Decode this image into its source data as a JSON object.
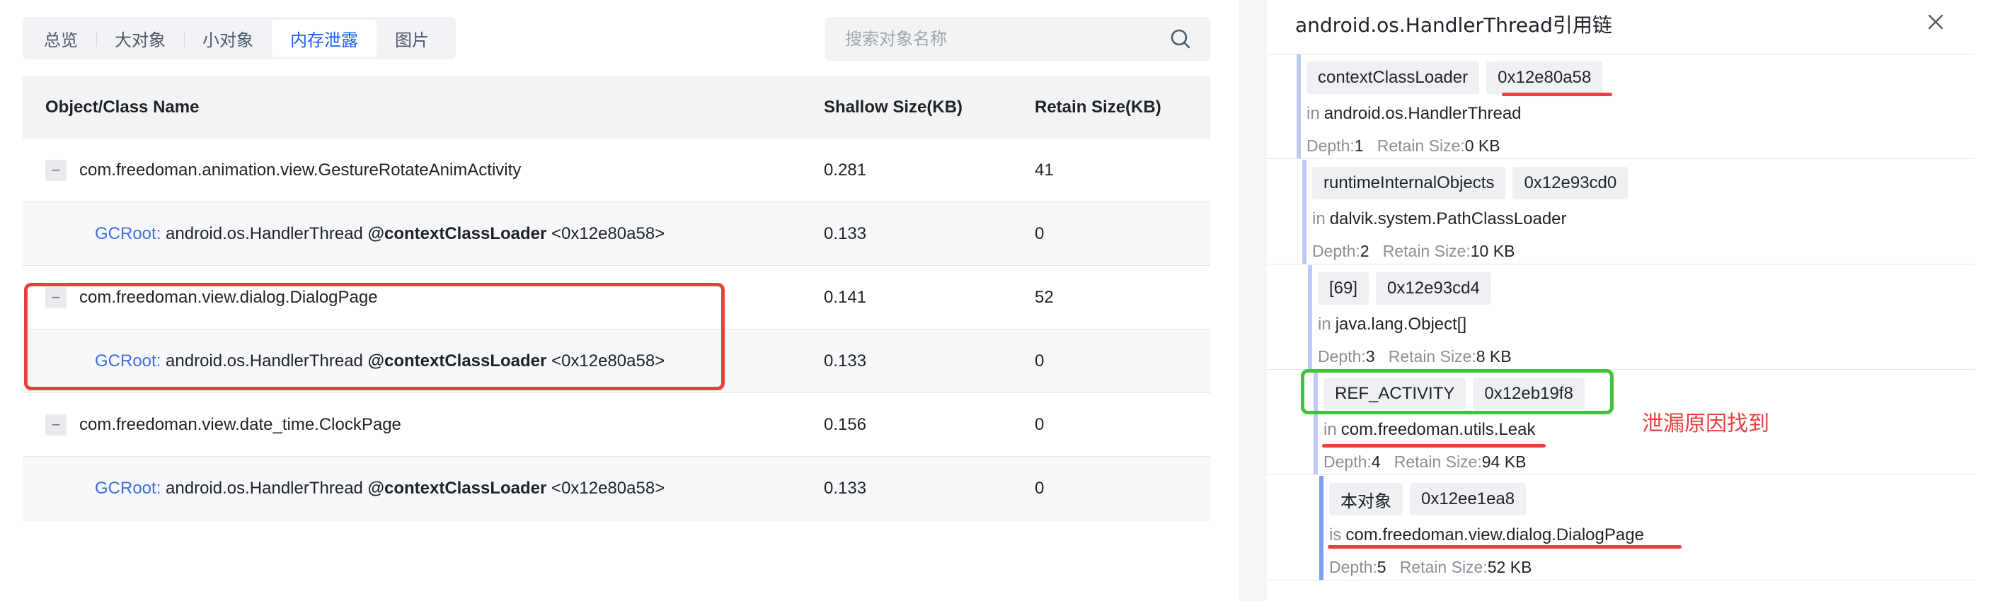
{
  "tabs": [
    {
      "label": "总览"
    },
    {
      "label": "大对象"
    },
    {
      "label": "小对象"
    },
    {
      "label": "内存泄露"
    },
    {
      "label": "图片"
    }
  ],
  "search": {
    "placeholder": "搜索对象名称",
    "value": ""
  },
  "table": {
    "headers": {
      "name": "Object/Class Name",
      "shallow": "Shallow Size(KB)",
      "retain": "Retain Size(KB)"
    },
    "rows": [
      {
        "name": "com.freedoman.animation.view.GestureRotateAnimActivity",
        "shallow": "0.281",
        "retain": "41"
      },
      {
        "gc_label": "GCRoot:",
        "class": "android.os.HandlerThread",
        "field": "@contextClassLoader",
        "addr": "<0x12e80a58>",
        "shallow": "0.133",
        "retain": "0"
      },
      {
        "name": "com.freedoman.view.dialog.DialogPage",
        "shallow": "0.141",
        "retain": "52"
      },
      {
        "gc_label": "GCRoot:",
        "class": "android.os.HandlerThread",
        "field": "@contextClassLoader",
        "addr": "<0x12e80a58>",
        "shallow": "0.133",
        "retain": "0"
      },
      {
        "name": "com.freedoman.view.date_time.ClockPage",
        "shallow": "0.156",
        "retain": "0"
      },
      {
        "gc_label": "GCRoot:",
        "class": "android.os.HandlerThread",
        "field": "@contextClassLoader",
        "addr": "<0x12e80a58>",
        "shallow": "0.133",
        "retain": "0"
      }
    ],
    "collapse_symbol": "−"
  },
  "panel": {
    "title": "android.os.HandlerThread引用链",
    "nodes": [
      {
        "tag": "contextClassLoader",
        "addr": "0x12e80a58",
        "prefix": "in",
        "class": "android.os.HandlerThread",
        "depth_label": "Depth:",
        "depth": "1",
        "retain_label": "Retain Size:",
        "retain": "0 KB"
      },
      {
        "tag": "runtimeInternalObjects",
        "addr": "0x12e93cd0",
        "prefix": "in",
        "class": "dalvik.system.PathClassLoader",
        "depth_label": "Depth:",
        "depth": "2",
        "retain_label": "Retain Size:",
        "retain": "10 KB"
      },
      {
        "tag": "[69]",
        "addr": "0x12e93cd4",
        "prefix": "in",
        "class": "java.lang.Object[]",
        "depth_label": "Depth:",
        "depth": "3",
        "retain_label": "Retain Size:",
        "retain": "8 KB"
      },
      {
        "tag": "REF_ACTIVITY",
        "addr": "0x12eb19f8",
        "prefix": "in",
        "class": "com.freedoman.utils.Leak",
        "depth_label": "Depth:",
        "depth": "4",
        "retain_label": "Retain Size:",
        "retain": "94 KB"
      },
      {
        "tag": "本对象",
        "addr": "0x12ee1ea8",
        "prefix": "is",
        "class": "com.freedoman.view.dialog.DialogPage",
        "depth_label": "Depth:",
        "depth": "5",
        "retain_label": "Retain Size:",
        "retain": "52 KB"
      }
    ],
    "annotation": "泄漏原因找到"
  },
  "colors": {
    "accent": "#165dff",
    "highlight_red": "#e8403c",
    "highlight_green": "#3cc43a"
  }
}
